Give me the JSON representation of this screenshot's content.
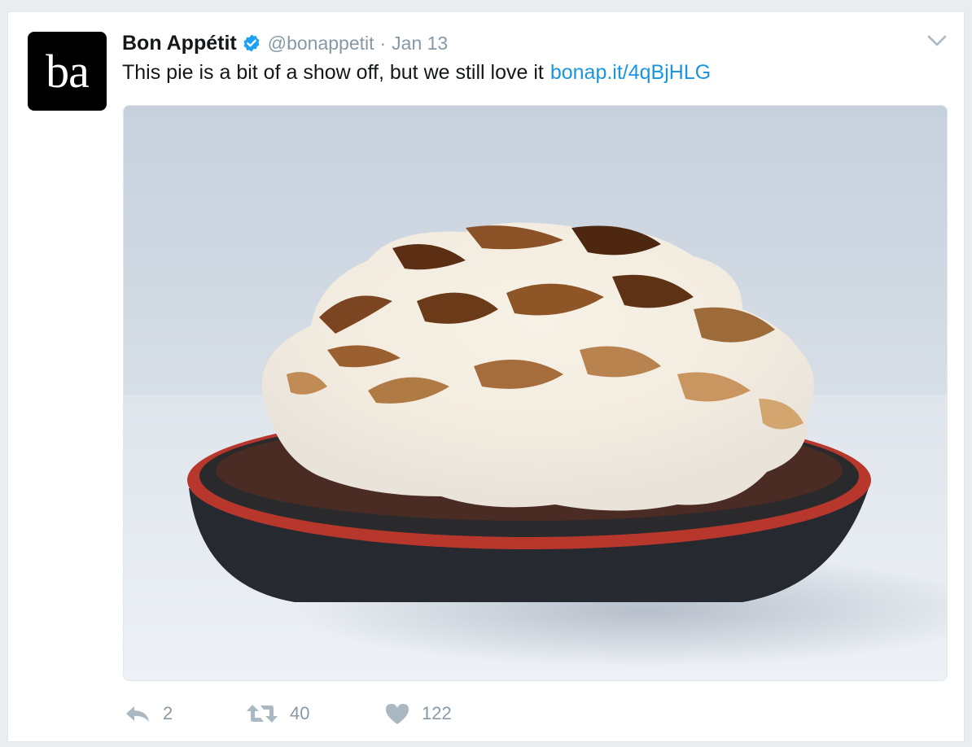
{
  "tweet": {
    "avatar_text": "ba",
    "name": "Bon Appétit",
    "handle": "@bonappetit",
    "separator": "·",
    "date": "Jan 13",
    "text": "This pie is a bit of a show off, but we still love it",
    "link": "bonap.it/4qBjHLG"
  },
  "actions": {
    "reply_count": "2",
    "retweet_count": "40",
    "like_count": "122"
  },
  "icons": {
    "verified": "verified-badge-icon",
    "caret": "chevron-down-icon",
    "reply": "reply-icon",
    "retweet": "retweet-icon",
    "like": "heart-icon"
  },
  "colors": {
    "link": "#1b95e0",
    "verified": "#1da1f2",
    "muted": "#8899a6"
  }
}
